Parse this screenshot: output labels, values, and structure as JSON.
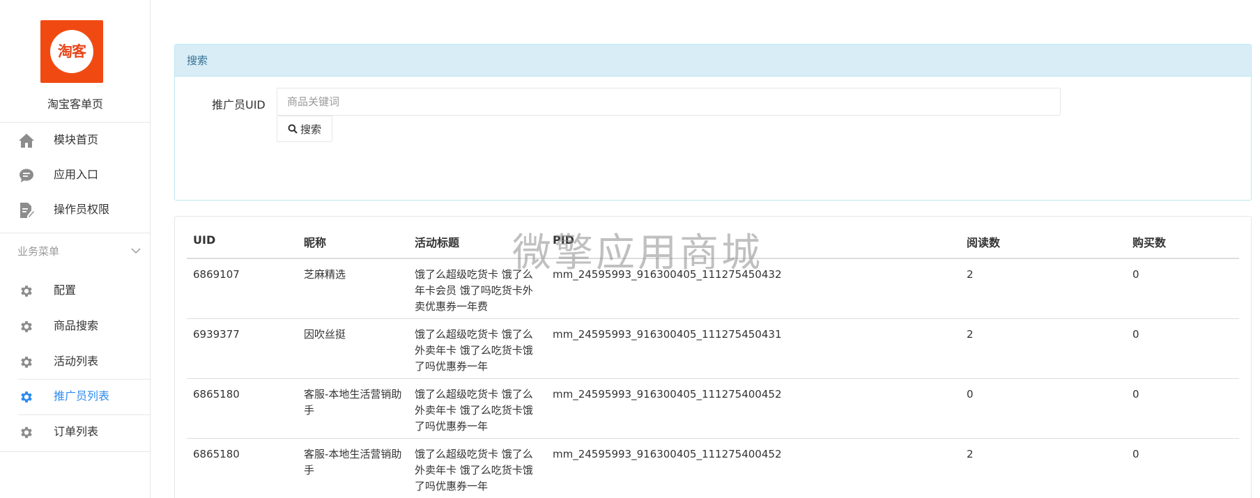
{
  "brand": {
    "logo_text": "淘客",
    "title": "淘宝客单页"
  },
  "nav_top": [
    {
      "label": "模块首页",
      "icon": "home-icon"
    },
    {
      "label": "应用入口",
      "icon": "chat-icon"
    },
    {
      "label": "操作员权限",
      "icon": "edit-doc-icon"
    }
  ],
  "section": {
    "title": "业务菜单"
  },
  "nav_biz": [
    {
      "label": "配置",
      "icon": "gear-icon"
    },
    {
      "label": "商品搜索",
      "icon": "gear-icon"
    },
    {
      "label": "活动列表",
      "icon": "gear-icon"
    },
    {
      "label": "推广员列表",
      "icon": "gear-icon",
      "active": true
    },
    {
      "label": "订单列表",
      "icon": "gear-icon"
    }
  ],
  "search_panel": {
    "heading": "搜索",
    "label": "推广员UID",
    "placeholder": "商品关键词",
    "button_label": "搜索"
  },
  "table": {
    "headers": [
      "UID",
      "昵称",
      "活动标题",
      "PID",
      "阅读数",
      "购买数"
    ],
    "rows": [
      {
        "uid": "6869107",
        "nick": "芝麻精选",
        "title": "饿了么超级吃货卡 饿了么年卡会员 饿了吗吃货卡外卖优惠券一年费",
        "pid": "mm_24595993_916300405_111275450432",
        "reads": "2",
        "buys": "0"
      },
      {
        "uid": "6939377",
        "nick": "因吹丝挺",
        "title": "饿了么超级吃货卡 饿了么外卖年卡 饿了么吃货卡饿了吗优惠券一年",
        "pid": "mm_24595993_916300405_111275450431",
        "reads": "2",
        "buys": "0"
      },
      {
        "uid": "6865180",
        "nick": "客服-本地生活营销助手",
        "title": "饿了么超级吃货卡 饿了么外卖年卡 饿了么吃货卡饿了吗优惠券一年",
        "pid": "mm_24595993_916300405_111275400452",
        "reads": "0",
        "buys": "0"
      },
      {
        "uid": "6865180",
        "nick": "客服-本地生活营销助手",
        "title": "饿了么超级吃货卡 饿了么外卖年卡 饿了么吃货卡饿了吗优惠券一年",
        "pid": "mm_24595993_916300405_111275400452",
        "reads": "2",
        "buys": "0"
      }
    ]
  },
  "watermark": "微擎应用商城",
  "colors": {
    "brand_orange": "#f04a12",
    "active_blue": "#2d8cf0",
    "panel_heading_bg": "#d9edf7",
    "panel_heading_text": "#31708f"
  }
}
